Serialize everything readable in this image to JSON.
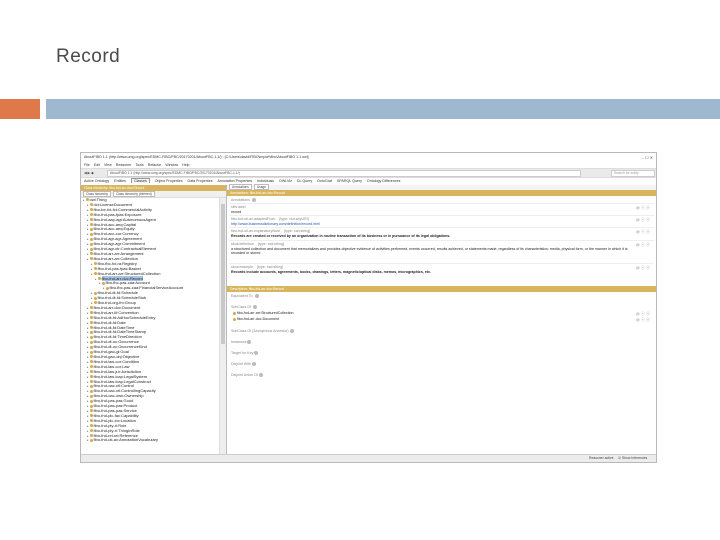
{
  "slide": {
    "title": "Record",
    "colors": {
      "accent_orange": "#e0794a",
      "accent_blue": "#9db8cf"
    }
  },
  "window": {
    "title": "AboutFIBO 1.1 (http://www.omg.org/spec/EDMC-FIBO/FBC/20170201/AboutFBC-1.1/) : [C:\\Users\\david\\FIBO\\import\\fibo\\AboutFIBO 1.1.owl]",
    "controls": "–  ☐  ✕"
  },
  "menu": [
    "File",
    "Edit",
    "View",
    "Reasoner",
    "Tools",
    "Refactor",
    "Window",
    "Help"
  ],
  "address": {
    "nav": "◀ ▶ ◆",
    "value": "AboutFIBO 1.1 (http://www.omg.org/spec/EDMC-FIBO/FBC/20170201/AboutFBC-1.1/)",
    "search_placeholder": "Search for entity"
  },
  "tabs": [
    "Active Ontology",
    "Entities",
    "Classes",
    "Object Properties",
    "Data Properties",
    "Annotation Properties",
    "Individuals",
    "OWLViz",
    "DL Query",
    "OntoGraf",
    "SPARQL Query",
    "Ontology Differences"
  ],
  "active_tab": "Classes",
  "left_panel": {
    "header": "Class hierarchy: fibo-fnd-arr-doc:Record",
    "subtabs": [
      "Class hierarchy",
      "Class hierarchy (inferred)"
    ],
    "tree": [
      {
        "label": "owl:Thing",
        "indent": 0
      },
      {
        "label": "dct:LicenseDocument",
        "indent": 1
      },
      {
        "label": "fibo-be-fct-fct:CommercialActivity",
        "indent": 1
      },
      {
        "label": "fibo-fnd-pas-fpas:Exposure",
        "indent": 1
      },
      {
        "label": "fibo-fnd-aap-agt:AutonomousAgent",
        "indent": 1
      },
      {
        "label": "fibo-fnd-acc-aeq:Capital",
        "indent": 1
      },
      {
        "label": "fibo-fnd-acc-aeq:Equity",
        "indent": 1
      },
      {
        "label": "fibo-fnd-acc-cur:Currency",
        "indent": 1
      },
      {
        "label": "fibo-fnd-agr-agr:Agreement",
        "indent": 1
      },
      {
        "label": "fibo-fnd-agr-agr:Commitment",
        "indent": 1
      },
      {
        "label": "fibo-fnd-agr-ctr:ContractualElement",
        "indent": 1
      },
      {
        "label": "fibo-fnd-arr-arr:Arrangement",
        "indent": 1
      },
      {
        "label": "fibo-fnd-arr-arr:Collection",
        "indent": 1
      },
      {
        "label": "fibo-fbc-fct-ra:Registry",
        "indent": 2
      },
      {
        "label": "fibo-fnd-pas-fpas:Basket",
        "indent": 2
      },
      {
        "label": "fibo-fnd-arr-arr:StructuredCollection",
        "indent": 2
      },
      {
        "label": "fibo-fnd-arr-doc:Record",
        "indent": 3,
        "selected": true
      },
      {
        "label": "fibo-fbc-pas-caa:Account",
        "indent": 4
      },
      {
        "label": "fibo-fbc-pas-caa:FinancialServiceAccount",
        "indent": 5
      },
      {
        "label": "fibo-fnd-dt-fd:Schedule",
        "indent": 2
      },
      {
        "label": "fibo-fnd-dt-fd:ScheduleStub",
        "indent": 2
      },
      {
        "label": "fibo-fnd-org-fm:Group",
        "indent": 2
      },
      {
        "label": "fibo-fnd-arr-doc:Document",
        "indent": 1
      },
      {
        "label": "fibo-fnd-arr-lif:Convention",
        "indent": 1
      },
      {
        "label": "fibo-fnd-dt-fd:AdHocScheduleEntry",
        "indent": 1
      },
      {
        "label": "fibo-fnd-dt-fd:Date",
        "indent": 1
      },
      {
        "label": "fibo-fnd-dt-fd:DateTime",
        "indent": 1
      },
      {
        "label": "fibo-fnd-dt-fd:DateTimeStamp",
        "indent": 1
      },
      {
        "label": "fibo-fnd-dt-fd:TimeDirection",
        "indent": 1
      },
      {
        "label": "fibo-fnd-dt-oc:Occurrence",
        "indent": 1
      },
      {
        "label": "fibo-fnd-dt-oc:OccurrenceKind",
        "indent": 1
      },
      {
        "label": "fibo-fnd-gao-gl:Goal",
        "indent": 1
      },
      {
        "label": "fibo-fnd-gao-obj:Objective",
        "indent": 1
      },
      {
        "label": "fibo-fnd-law-cor:Condition",
        "indent": 1
      },
      {
        "label": "fibo-fnd-law-cor:Law",
        "indent": 1
      },
      {
        "label": "fibo-fnd-law-jur:Jurisdiction",
        "indent": 1
      },
      {
        "label": "fibo-fnd-law-lcap:LegalSystem",
        "indent": 1
      },
      {
        "label": "fibo-fnd-law-lcap:LegalConstruct",
        "indent": 1
      },
      {
        "label": "fibo-fnd-oac-ctl:Control",
        "indent": 1
      },
      {
        "label": "fibo-fnd-oac-ctl:ControllingCapacity",
        "indent": 1
      },
      {
        "label": "fibo-fnd-oac-own:Ownership",
        "indent": 1
      },
      {
        "label": "fibo-fnd-pas-pas:Good",
        "indent": 1
      },
      {
        "label": "fibo-fnd-pas-pas:Product",
        "indent": 1
      },
      {
        "label": "fibo-fnd-pas-pas:Service",
        "indent": 1
      },
      {
        "label": "fibo-fnd-plc-fac:Capability",
        "indent": 1
      },
      {
        "label": "fibo-fnd-plc-loc:Location",
        "indent": 1
      },
      {
        "label": "fibo-fnd-pty-rl:Role",
        "indent": 1
      },
      {
        "label": "fibo-fnd-pty-rl:ThingInRole",
        "indent": 1
      },
      {
        "label": "fibo-fnd-rel-rel:Reference",
        "indent": 1
      },
      {
        "label": "fibo-fnd-utl-av:AnnotationVocabulary",
        "indent": 1
      }
    ]
  },
  "right_panel": {
    "subtabs": [
      "Annotations",
      "Usage"
    ],
    "annotations_header": "Annotations: fibo-fnd-arr-doc:Record",
    "annotations_label": "Annotations",
    "annotations": [
      {
        "prop": "rdfs:label",
        "value": "record",
        "type": ""
      },
      {
        "prop": "fibo-fnd-utl-av:adaptedFrom",
        "type": "[type: xsd:anyURI]",
        "value": "http://www.businessdictionary.com/definition/record.html"
      },
      {
        "prop": "fibo-fnd-utl-av:explanatoryNote",
        "type": "[type: xsd:string]",
        "value": "Records are created or received by an organization in routine transaction of its business or in pursuance of its legal obligations."
      },
      {
        "prop": "skos:definition",
        "type": "[type: xsd:string]",
        "value": "a structured collection and document that memorializes and provides objective evidence of activities performed, events occurred, results achieved, or statements made, regardless of its characteristics: media, physical form, or the manner in which it is recorded or stored"
      },
      {
        "prop": "skos:example",
        "type": "[type: xsd:string]",
        "value": "Records include accounts, agreements, books, drawings, letters, magnetic/optical disks, memos, micrographics, etc."
      }
    ],
    "description_header": "Description: fibo-fnd-arr-doc:Record",
    "equivalent_to": "Equivalent To",
    "subclass_of": "SubClass Of",
    "superclasses": [
      "fibo-fnd-arr-arr:StructuredCollection",
      "fibo-fnd-arr-doc:Document"
    ],
    "other_sections": [
      "SubClass Of (Anonymous Ancestor)",
      "Instances",
      "Target for Key",
      "Disjoint With",
      "Disjoint Union Of"
    ]
  },
  "status": {
    "reasoner": "Reasoner active",
    "inferences": "Show Inferences"
  }
}
